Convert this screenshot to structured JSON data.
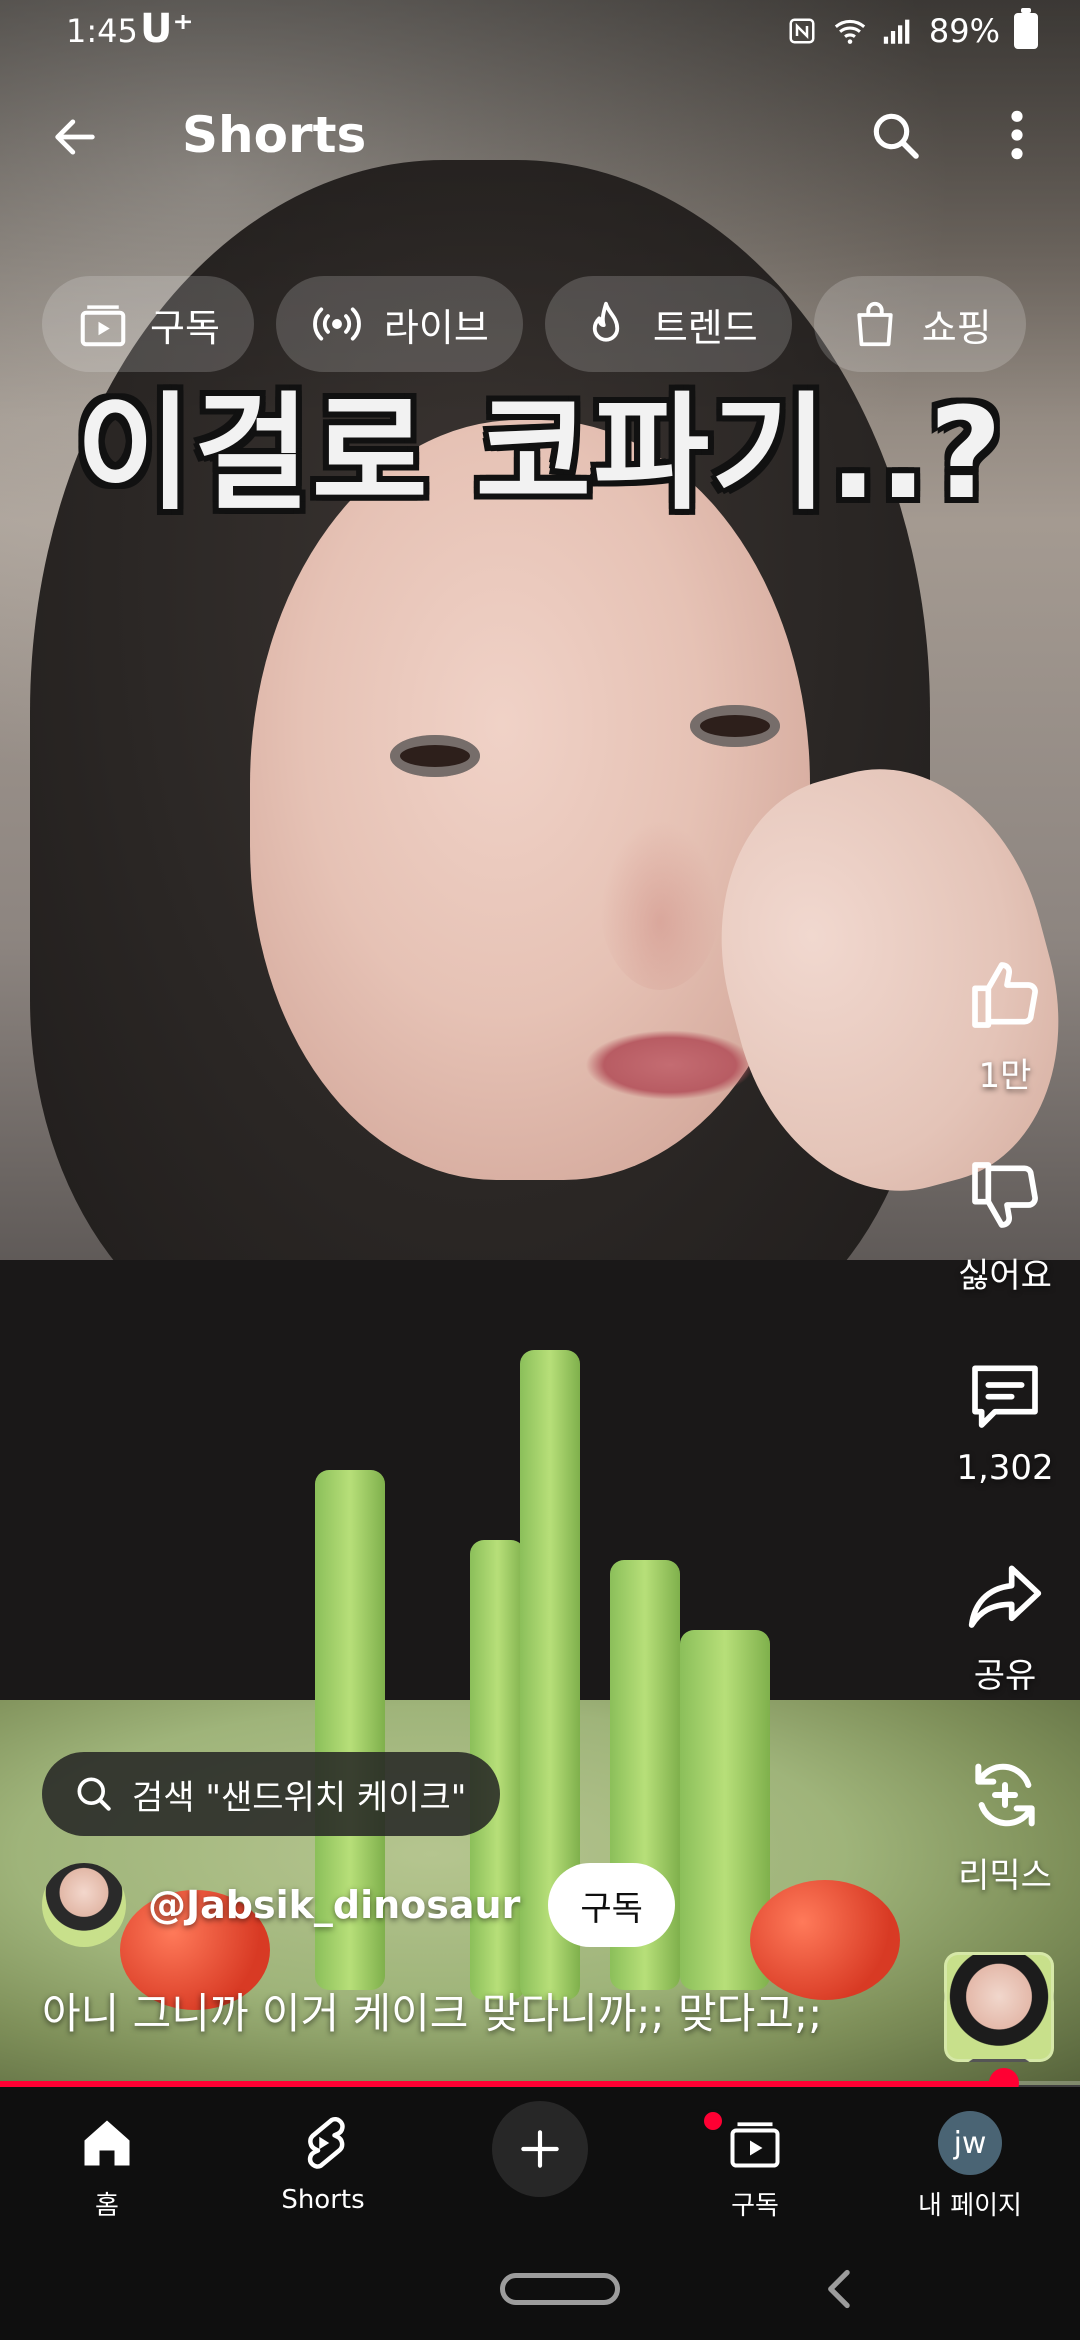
{
  "status_bar": {
    "time": "1:45",
    "carrier": "U⁺",
    "battery": "89%",
    "icons": [
      "nfc-icon",
      "wifi-icon",
      "signal-icon",
      "battery-icon"
    ]
  },
  "top_bar": {
    "title": "Shorts",
    "icons": [
      "back-arrow-icon",
      "search-icon",
      "more-vert-icon"
    ]
  },
  "chips": [
    {
      "label": "구독",
      "icon": "subscriptions-icon"
    },
    {
      "label": "라이브",
      "icon": "live-icon"
    },
    {
      "label": "트렌드",
      "icon": "trending-icon"
    },
    {
      "label": "쇼핑",
      "icon": "shopping-bag-icon"
    }
  ],
  "video": {
    "caption": "이걸로 코파기..?"
  },
  "actions": {
    "like_count": "1만",
    "dislike_label": "싫어요",
    "comment_count": "1,302",
    "share_label": "공유",
    "remix_label": "리믹스"
  },
  "search_suggestion": {
    "text": "검색 \"샌드위치 케이크\""
  },
  "channel": {
    "handle": "@Jabsik_dinosaur",
    "subscribe_label": "구독"
  },
  "description": "아니 그니까 이거 케이크 맞다니까;; 맞다고;;",
  "progress": {
    "fraction": 0.93,
    "color": "#ff0033"
  },
  "bottom_nav": {
    "home": "홈",
    "shorts": "Shorts",
    "subscriptions": "구독",
    "me": "내 페이지",
    "me_initials": "jw"
  }
}
